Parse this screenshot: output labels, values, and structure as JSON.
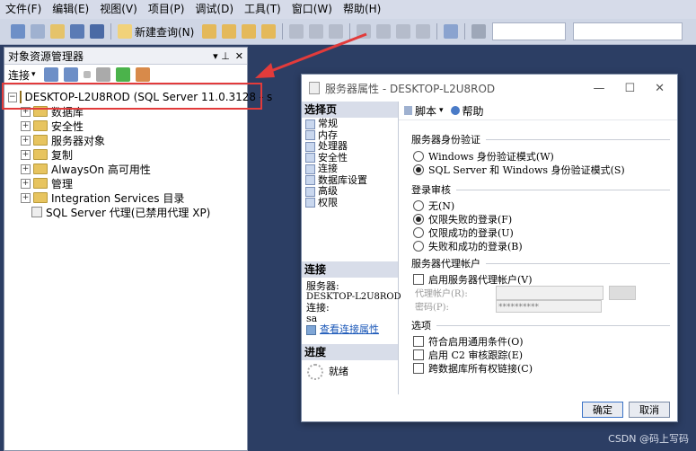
{
  "menu": [
    "文件(F)",
    "编辑(E)",
    "视图(V)",
    "项目(P)",
    "调试(D)",
    "工具(T)",
    "窗口(W)",
    "帮助(H)"
  ],
  "toolbar": {
    "new_query": "新建查询(N)"
  },
  "object_explorer": {
    "title": "对象资源管理器",
    "pin": "▾ ⊥",
    "close": "✕",
    "connect": "连接",
    "server": "DESKTOP-L2U8ROD (SQL Server 11.0.3128 - s",
    "nodes": [
      "数据库",
      "安全性",
      "服务器对象",
      "复制",
      "AlwaysOn 高可用性",
      "管理",
      "Integration Services 目录"
    ],
    "agent": "SQL Server 代理(已禁用代理 XP)"
  },
  "dialog": {
    "title": "服务器属性 - DESKTOP-L2U8ROD",
    "select_page": "选择页",
    "pages": [
      "常规",
      "内存",
      "处理器",
      "安全性",
      "连接",
      "数据库设置",
      "高级",
      "权限"
    ],
    "script": "脚本",
    "help": "帮助",
    "connection_hdr": "连接",
    "server_label": "服务器:",
    "server_value": "DESKTOP-L2U8ROD",
    "conn_label": "连接:",
    "conn_value": "sa",
    "view_conn": "查看连接属性",
    "progress_hdr": "进度",
    "progress_status": "就绪",
    "auth_group": "服务器身份验证",
    "auth_windows": "Windows 身份验证模式(W)",
    "auth_mixed": "SQL Server 和 Windows 身份验证模式(S)",
    "audit_group": "登录审核",
    "audit_none": "无(N)",
    "audit_failed": "仅限失败的登录(F)",
    "audit_success": "仅限成功的登录(U)",
    "audit_both": "失败和成功的登录(B)",
    "proxy_group": "服务器代理帐户",
    "proxy_enable": "启用服务器代理帐户(V)",
    "proxy_account": "代理帐户(R):",
    "proxy_password": "密码(P):",
    "proxy_password_value": "**********",
    "options_group": "选项",
    "opt_c2": "符合启用通用条件(O)",
    "opt_c2trace": "启用 C2 审核跟踪(E)",
    "opt_chain": "跨数据库所有权链接(C)",
    "ok": "确定",
    "cancel": "取消"
  },
  "watermark": "CSDN @码上写码",
  "colors": {
    "highlight": "#e23b3b",
    "background": "#2c3e64"
  }
}
